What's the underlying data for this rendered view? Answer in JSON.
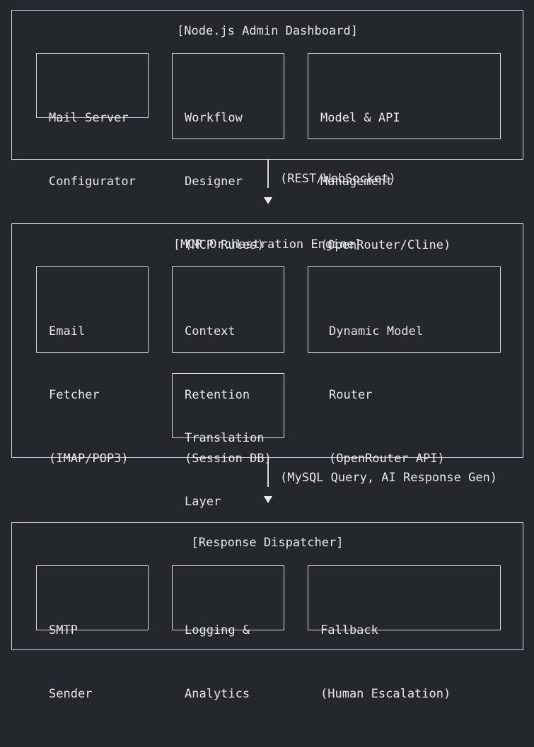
{
  "diagram": {
    "sections": [
      {
        "title": "[Node.js Admin Dashboard]",
        "boxes": [
          {
            "lines": [
              "Mail Server",
              "Configurator"
            ]
          },
          {
            "lines": [
              "Workflow",
              "Designer",
              "(MCP Rules)"
            ]
          },
          {
            "lines": [
              "Model & API",
              "Management",
              "(OpenRouter/Cline)"
            ]
          }
        ]
      },
      {
        "title": "[MCP Orchestration Engine]",
        "boxes": [
          {
            "lines": [
              "Email",
              "Fetcher",
              "(IMAP/POP3)"
            ]
          },
          {
            "lines": [
              "Context",
              "Retention",
              "(Session DB)"
            ]
          },
          {
            "lines": [
              "Dynamic Model",
              "Router",
              "(OpenRouter API)"
            ]
          },
          {
            "lines": [
              "Translation",
              "Layer"
            ]
          }
        ]
      },
      {
        "title": "[Response Dispatcher]",
        "boxes": [
          {
            "lines": [
              "SMTP",
              "Sender"
            ]
          },
          {
            "lines": [
              "Logging &",
              "Analytics"
            ]
          },
          {
            "lines": [
              "Fallback",
              "(Human Escalation)"
            ]
          }
        ]
      }
    ],
    "connectors": [
      {
        "label": "(REST/WebSocket)"
      },
      {
        "label": "(MySQL Query, AI Response Gen)"
      }
    ]
  }
}
